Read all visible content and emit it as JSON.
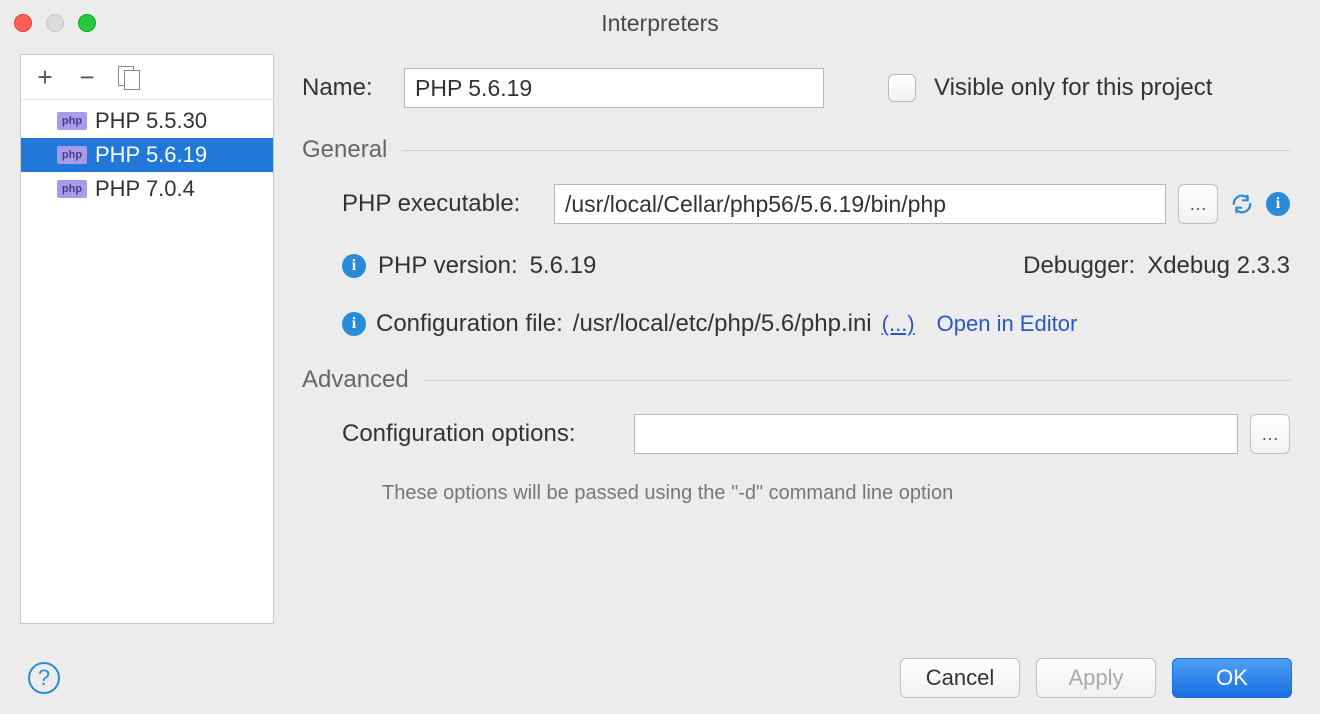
{
  "window_title": "Interpreters",
  "sidebar": {
    "items": [
      {
        "label": "PHP 5.5.30",
        "selected": false
      },
      {
        "label": "PHP 5.6.19",
        "selected": true
      },
      {
        "label": "PHP 7.0.4",
        "selected": false
      }
    ]
  },
  "form": {
    "name_label": "Name:",
    "name_value": "PHP 5.6.19",
    "visible_only_label": "Visible only for this project",
    "visible_only_checked": false
  },
  "general": {
    "section_title": "General",
    "executable_label": "PHP executable:",
    "executable_value": "/usr/local/Cellar/php56/5.6.19/bin/php",
    "version_label": "PHP version:",
    "version_value": "5.6.19",
    "debugger_label": "Debugger:",
    "debugger_value": "Xdebug 2.3.3",
    "config_label": "Configuration file:",
    "config_value": "/usr/local/etc/php/5.6/php.ini",
    "more_link": "(...)",
    "open_editor": "Open in Editor"
  },
  "advanced": {
    "section_title": "Advanced",
    "options_label": "Configuration options:",
    "options_value": "",
    "hint": "These options will be passed using the \"-d\" command line option"
  },
  "buttons": {
    "cancel": "Cancel",
    "apply": "Apply",
    "ok": "OK"
  }
}
